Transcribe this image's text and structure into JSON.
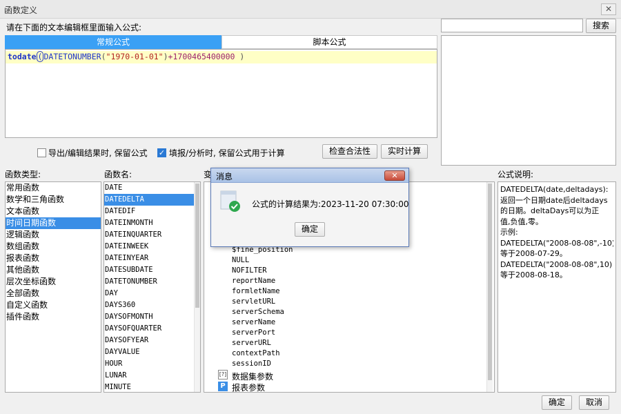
{
  "window": {
    "title": "函数定义",
    "close_glyph": "✕"
  },
  "instruction": "请在下面的文本编辑框里面输入公式:",
  "search": {
    "button": "搜索",
    "value": ""
  },
  "tabs": {
    "normal": "常规公式",
    "script": "脚本公式",
    "active": "normal"
  },
  "formula": {
    "p1": "todate",
    "p2": "(",
    "p3": "DATETONUMBER",
    "p4": "(",
    "p5": "\"1970-01-01\"",
    "p6": ")",
    "p7": "+1700465400000",
    "p8": " )"
  },
  "options": {
    "keep_on_export": {
      "label": "导出/编辑结果时, 保留公式",
      "checked": false
    },
    "keep_on_fill": {
      "label": "填报/分析时, 保留公式用于计算",
      "checked": true
    },
    "check_button": "检查合法性",
    "realtime_button": "实时计算"
  },
  "categories": {
    "label": "函数类型:",
    "items": [
      "常用函数",
      "数学和三角函数",
      "文本函数",
      "时间日期函数",
      "逻辑函数",
      "数组函数",
      "报表函数",
      "其他函数",
      "层次坐标函数",
      "全部函数",
      "自定义函数",
      "插件函数"
    ],
    "selected_index": 3
  },
  "functions": {
    "label": "函数名:",
    "items": [
      "DATE",
      "DATEDELTA",
      "DATEDIF",
      "DATEINMONTH",
      "DATEINQUARTER",
      "DATEINWEEK",
      "DATEINYEAR",
      "DATESUBDATE",
      "DATETONUMBER",
      "DAY",
      "DAYS360",
      "DAYSOFMONTH",
      "DAYSOFQUARTER",
      "DAYSOFYEAR",
      "DAYVALUE",
      "HOUR",
      "LUNAR",
      "MINUTE"
    ],
    "selected_index": 1
  },
  "variables": {
    "label_visible": "变",
    "items": [
      "$fine_position",
      "NULL",
      "NOFILTER",
      "reportName",
      "formletName",
      "servletURL",
      "serverSchema",
      "serverName",
      "serverPort",
      "serverURL",
      "contextPath",
      "sessionID"
    ],
    "groups": {
      "dataset_params": "数据集参数",
      "report_params": "报表参数"
    }
  },
  "description": {
    "label": "公式说明:",
    "lines": [
      "DATEDELTA(date,deltadays):",
      "返回一个日期date后deltadays",
      "的日期。deltaDays可以为正",
      "值,负值,零。",
      "示例:",
      "DATEDELTA(\"2008-08-08\",-10)",
      "等于2008-07-29。",
      "DATEDELTA(\"2008-08-08\",10)",
      "等于2008-08-18。"
    ]
  },
  "message": {
    "title": "消息",
    "text": "公式的计算结果为:2023-11-20 07:30:00",
    "ok": "确定",
    "close_glyph": "✕"
  },
  "footer": {
    "ok": "确定",
    "cancel": "取消"
  },
  "colors": {
    "accent": "#3aa0f5",
    "selection": "#3a8ee6",
    "editor_line": "#ffffc6"
  }
}
